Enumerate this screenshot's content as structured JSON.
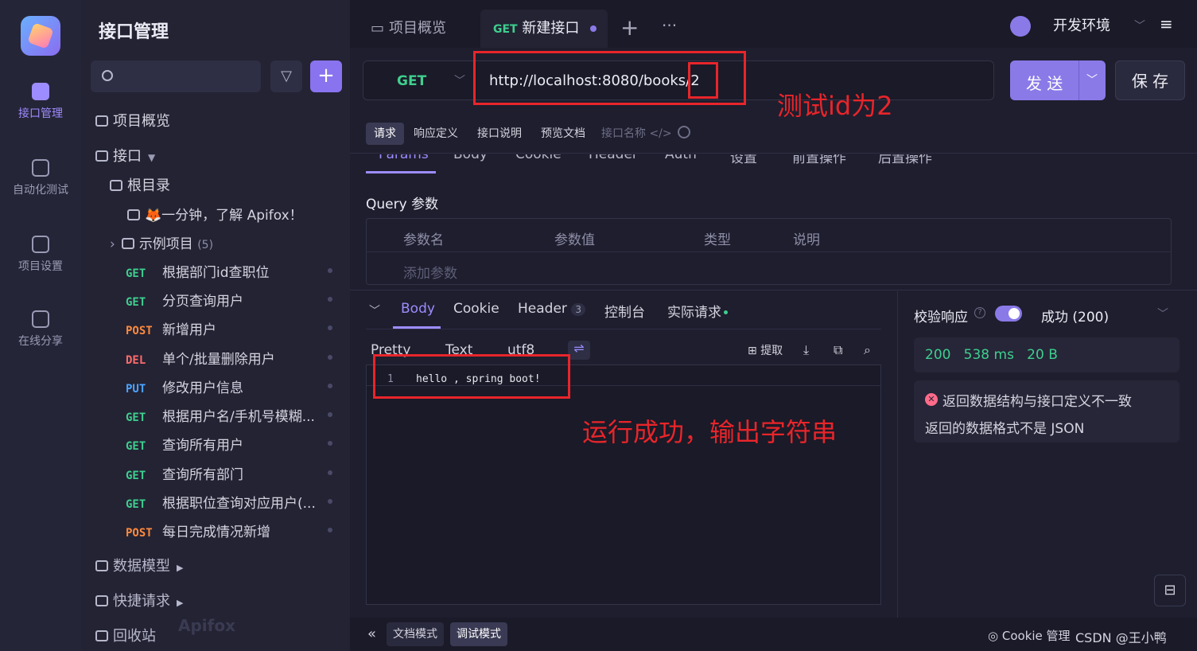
{
  "rail": {
    "items": [
      "接口管理",
      "自动化测试",
      "项目设置",
      "在线分享"
    ]
  },
  "sidebar": {
    "title": "接口管理",
    "overview": "项目概览",
    "api_group": "接口",
    "root": "根目录",
    "intro": "🦊一分钟，了解 Apifox！",
    "example": "示例项目",
    "example_count": "(5)",
    "apis": [
      {
        "method": "GET",
        "name": "根据部门id查职位"
      },
      {
        "method": "GET",
        "name": "分页查询用户"
      },
      {
        "method": "POST",
        "name": "新增用户"
      },
      {
        "method": "DEL",
        "name": "单个/批量删除用户"
      },
      {
        "method": "PUT",
        "name": "修改用户信息"
      },
      {
        "method": "GET",
        "name": "根据用户名/手机号模糊..."
      },
      {
        "method": "GET",
        "name": "查询所有用户"
      },
      {
        "method": "GET",
        "name": "查询所有部门"
      },
      {
        "method": "GET",
        "name": "根据职位查询对应用户(..."
      },
      {
        "method": "POST",
        "name": "每日完成情况新增"
      }
    ],
    "data_model": "数据模型",
    "quick_request": "快捷请求",
    "recycle": "回收站",
    "watermark": "Apifox"
  },
  "tabs": {
    "overview": "项目概览",
    "active_method": "GET",
    "active_label": "新建接口",
    "add": "+",
    "more": "···"
  },
  "env": {
    "label": "开发环境"
  },
  "request": {
    "method": "GET",
    "url": "http://localhost:8080/books/2",
    "send": "发 送",
    "save": "保 存"
  },
  "subtabs": [
    "请求",
    "响应定义",
    "接口说明",
    "预览文档",
    "接口名称 </>"
  ],
  "param_tabs": [
    "Params",
    "Body",
    "Cookie",
    "Header",
    "Auth",
    "设置",
    "前置操作",
    "后置操作"
  ],
  "query": {
    "title": "Query 参数",
    "headers": [
      "参数名",
      "参数值",
      "类型",
      "说明"
    ],
    "add": "添加参数"
  },
  "response": {
    "tabs": [
      "Body",
      "Cookie",
      "Header",
      "控制台",
      "实际请求"
    ],
    "header_count": "3",
    "format": [
      "Pretty",
      "Text",
      "utf8"
    ],
    "extract": "提取",
    "line_no": "1",
    "body": "hello , spring boot!"
  },
  "validate": {
    "label": "校验响应",
    "result": "成功 (200)",
    "status": "200",
    "time": "538 ms",
    "size": "20 B",
    "error1": "返回数据结构与接口定义不一致",
    "error2": "返回的数据格式不是 JSON"
  },
  "bottom": {
    "doc_mode": "文档模式",
    "debug_mode": "调试模式",
    "cookie": "Cookie 管理",
    "credit": "CSDN @王小鸭"
  },
  "annotations": {
    "test_id": "测试id为2",
    "success": "运行成功，输出字符串"
  }
}
